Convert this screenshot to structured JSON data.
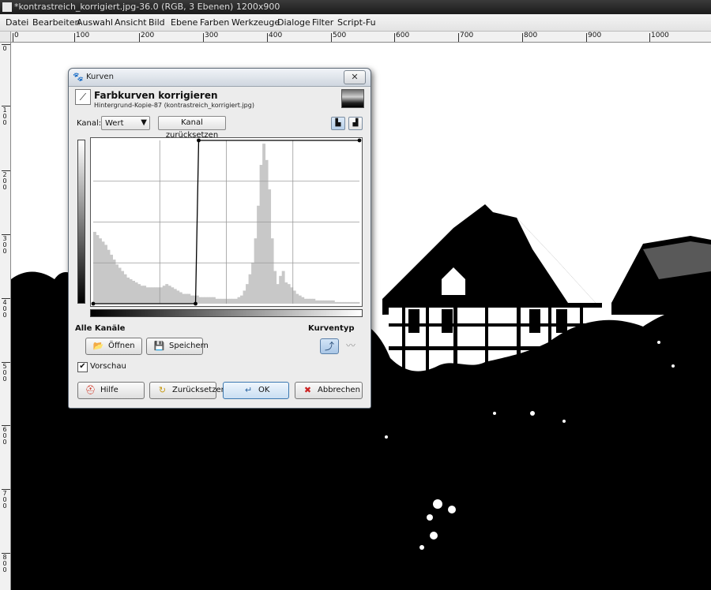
{
  "window": {
    "title": "*kontrastreich_korrigiert.jpg-36.0 (RGB, 3 Ebenen) 1200x900"
  },
  "menubar": {
    "items": [
      "Datei",
      "Bearbeiten",
      "Auswahl",
      "Ansicht",
      "Bild",
      "Ebene",
      "Farben",
      "Werkzeuge",
      "Dialoge",
      "Filter",
      "Script-Fu"
    ]
  },
  "ruler": {
    "horizontal_labels": [
      "0",
      "100",
      "200",
      "300",
      "400",
      "500",
      "600",
      "700",
      "800",
      "900",
      "1000"
    ],
    "vertical_labels": [
      "0",
      "100",
      "200",
      "300",
      "400",
      "500",
      "600",
      "700",
      "800"
    ]
  },
  "dialog": {
    "title": "Kurven",
    "heading": "Farbkurven korrigieren",
    "subtitle": "Hintergrund-Kopie-87 (kontrastreich_korrigiert.jpg)",
    "channel_label": "Kanal:",
    "channel_value": "Wert",
    "reset_channel": "Kanal zurücksetzen",
    "all_channels": "Alle Kanäle",
    "curve_type": "Kurventyp",
    "open": "Öffnen",
    "save": "Speichern",
    "preview": "Vorschau",
    "preview_checked": true,
    "help": "Hilfe",
    "reset": "Zurücksetzen",
    "ok": "OK",
    "cancel": "Abbrechen"
  },
  "curve": {
    "points": [
      [
        0,
        0
      ],
      [
        98,
        0
      ],
      [
        101,
        255
      ],
      [
        255,
        255
      ]
    ],
    "x_range": [
      0,
      255
    ],
    "y_range": [
      0,
      255
    ]
  },
  "histogram": {
    "values": [
      44,
      42,
      40,
      38,
      36,
      33,
      30,
      27,
      24,
      22,
      20,
      18,
      16,
      15,
      14,
      13,
      12,
      11,
      11,
      10,
      10,
      10,
      10,
      10,
      10,
      11,
      12,
      11,
      10,
      9,
      8,
      7,
      6,
      6,
      6,
      5,
      5,
      5,
      4,
      4,
      4,
      4,
      4,
      4,
      3,
      3,
      3,
      3,
      3,
      3,
      3,
      3,
      4,
      5,
      8,
      12,
      18,
      25,
      40,
      60,
      85,
      98,
      88,
      70,
      40,
      20,
      12,
      17,
      20,
      13,
      12,
      10,
      8,
      6,
      5,
      4,
      3,
      3,
      3,
      3,
      2,
      2,
      2,
      2,
      2,
      2,
      2,
      1,
      1,
      1,
      1,
      1,
      1,
      1,
      1,
      1
    ]
  },
  "colors": {
    "accent": "#3b78b0",
    "histogram_fill": "#c8c8c8",
    "grid": "#9a9a9a"
  }
}
